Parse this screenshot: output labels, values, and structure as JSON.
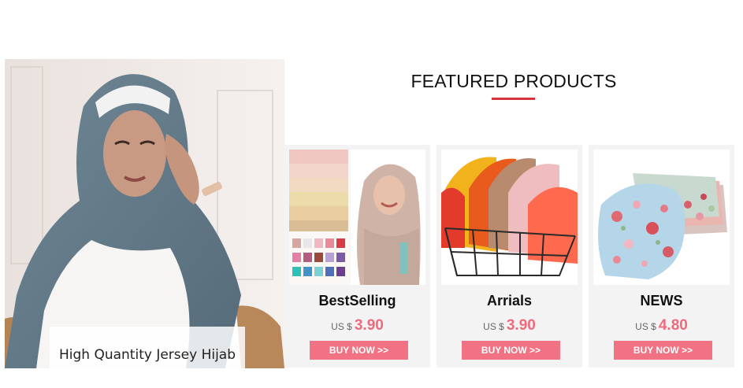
{
  "hero": {
    "caption": "High Quantity Jersey Hijab"
  },
  "featured": {
    "title": "FEATURED PRODUCTS",
    "accent_color": "#d7343c"
  },
  "products": [
    {
      "name": "BestSelling",
      "currency": "US $",
      "price": "3.90",
      "button": "BUY NOW >>"
    },
    {
      "name": "Arrials",
      "currency": "US $",
      "price": "3.90",
      "button": "BUY NOW >>"
    },
    {
      "name": "NEWS",
      "currency": "US $",
      "price": "4.80",
      "button": "BUY NOW >>"
    }
  ],
  "colors": {
    "price": "#ef6b7c",
    "button_bg": "#f07283",
    "card_bg": "#f3f3f3"
  }
}
